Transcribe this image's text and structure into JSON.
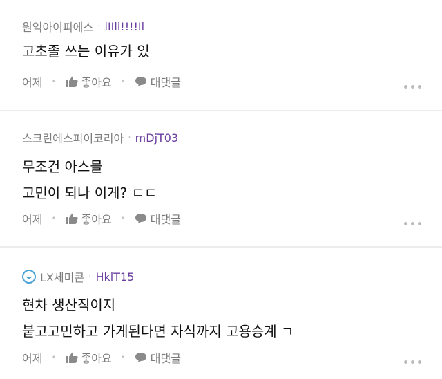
{
  "comments": [
    {
      "company": "원익아이피에스",
      "nickname": "iIIli!!!!Il",
      "lines": [
        "고초졸 쓰는 이유가 있"
      ],
      "time": "어제",
      "like_label": "좋아요",
      "reply_label": "대댓글"
    },
    {
      "company": "스크린에스피이코리아",
      "nickname": "mDjT03",
      "lines": [
        "무조건 아스믈",
        "고민이 되나 이게? ㄷㄷ"
      ],
      "time": "어제",
      "like_label": "좋아요",
      "reply_label": "대댓글"
    },
    {
      "company": "LX세미콘",
      "nickname": "HklT15",
      "lines": [
        "현차 생산직이지",
        "붙고고민하고 가게된다면 자식까지 고용승계 ㄱ"
      ],
      "time": "어제",
      "like_label": "좋아요",
      "reply_label": "대댓글"
    }
  ],
  "colors": {
    "nickname": "#6a3fa0",
    "company": "#7d7d7d",
    "action": "#7a7a7a",
    "badge": "#4aa2d6",
    "divider": "#ececec"
  },
  "icons": {
    "like": "thumbs-up-icon",
    "reply": "speech-bubble-icon",
    "more": "more-dots-icon",
    "company_badge": "company-badge-icon"
  }
}
